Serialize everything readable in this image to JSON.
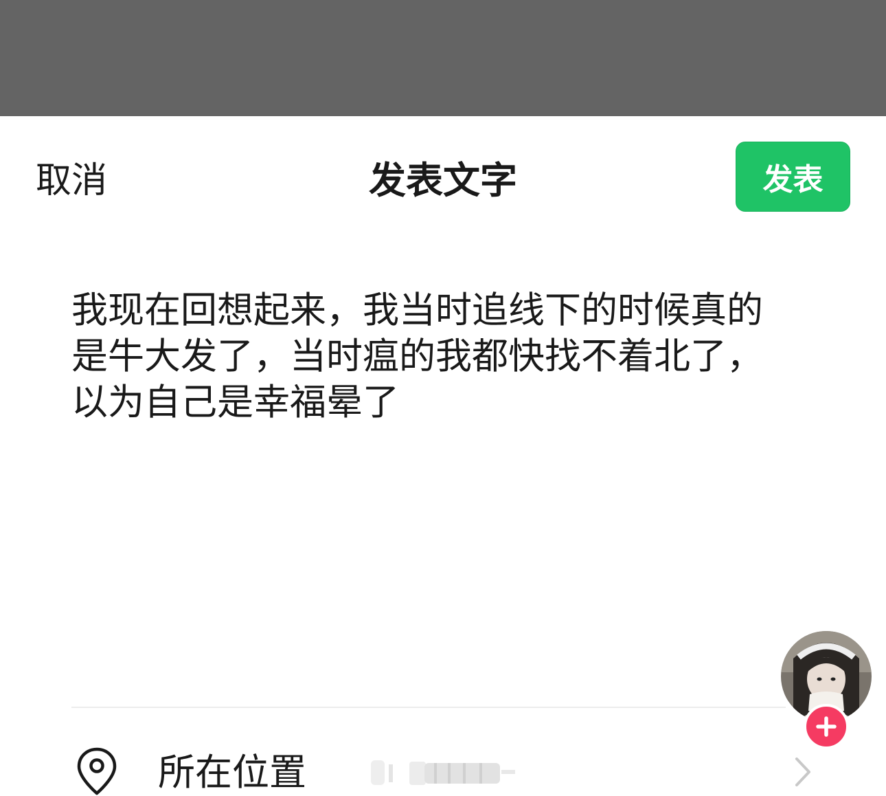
{
  "header": {
    "cancel_label": "取消",
    "title": "发表文字",
    "publish_label": "发表"
  },
  "post": {
    "text": "我现在回想起来，我当时追线下的时候真的\n是牛大发了，当时瘟的我都快找不着北了，\n以为自己是幸福晕了"
  },
  "location": {
    "label": "所在位置",
    "icon": "location-pin-icon"
  },
  "colors": {
    "accent": "#1fc366",
    "topbar": "#646464",
    "add_badge": "#f53b62"
  }
}
